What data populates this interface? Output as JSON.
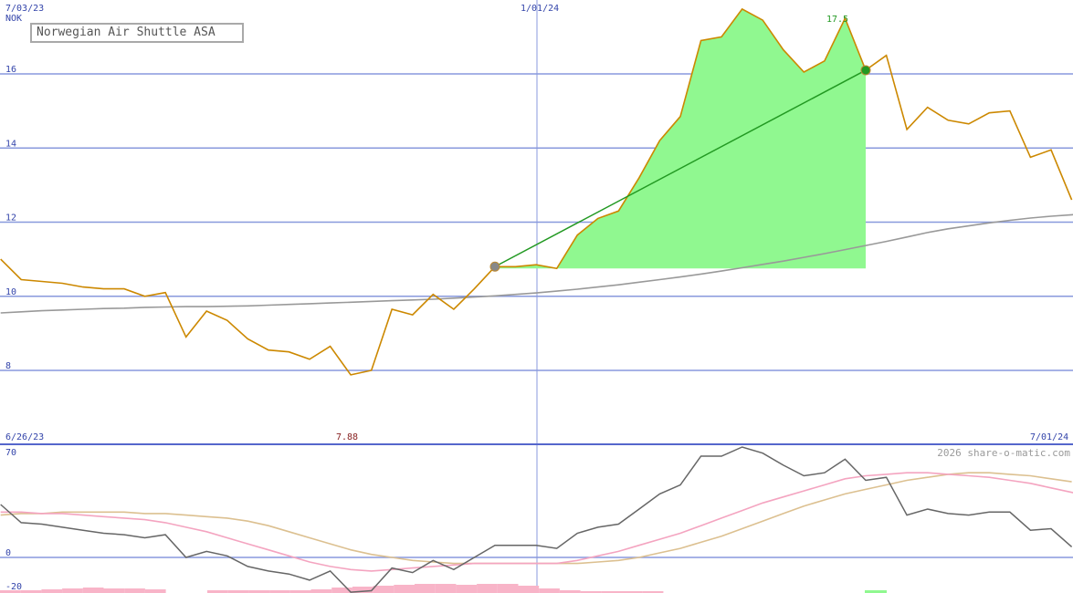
{
  "title": "Norwegian Air Shuttle ASA",
  "watermark": "2026 share-o-matic.com",
  "colors": {
    "price": "#cc8800",
    "ma": "#999999",
    "fill": "#90f890",
    "trend": "#229922",
    "grid": "#8899dd",
    "axis_text": "#3344aa",
    "high_label": "#229922",
    "low_label": "#882222",
    "osc_line": "#666666",
    "osc_pink": "#f4a4c0",
    "osc_tan": "#dcc090",
    "hist_pink": "#f8b4c8",
    "hist_green": "#90f890"
  },
  "chart_data": [
    {
      "type": "line",
      "name": "price",
      "date_labels": {
        "top_left": "7/03/23",
        "top_mid": "1/01/24",
        "bottom_left": "6/26/23",
        "bottom_right": "7/01/24"
      },
      "unit_label": "NOK",
      "ylim": [
        7.1,
        17.8
      ],
      "yticks": [
        8,
        10,
        12,
        14,
        16
      ],
      "high_label": "17.5",
      "low_label": "7.88",
      "series_price": [
        11.0,
        10.45,
        10.4,
        10.35,
        10.25,
        10.2,
        10.2,
        10.0,
        10.1,
        8.9,
        9.6,
        9.35,
        8.85,
        8.55,
        8.5,
        8.3,
        8.65,
        7.88,
        8.0,
        9.65,
        9.5,
        10.05,
        9.65,
        10.2,
        10.8,
        10.8,
        10.85,
        10.75,
        11.65,
        12.1,
        12.3,
        13.2,
        14.2,
        14.85,
        16.9,
        17.0,
        17.75,
        17.45,
        16.65,
        16.05,
        16.35,
        17.5,
        16.1,
        16.5,
        14.5,
        15.1,
        14.75,
        14.65,
        14.95,
        15.0,
        13.75,
        13.95,
        12.6
      ],
      "series_ma": [
        9.55,
        9.58,
        9.61,
        9.63,
        9.65,
        9.67,
        9.68,
        9.7,
        9.71,
        9.72,
        9.72,
        9.73,
        9.74,
        9.76,
        9.78,
        9.8,
        9.82,
        9.84,
        9.86,
        9.88,
        9.9,
        9.92,
        9.95,
        9.98,
        10.01,
        10.05,
        10.09,
        10.14,
        10.19,
        10.25,
        10.31,
        10.38,
        10.45,
        10.52,
        10.6,
        10.68,
        10.77,
        10.86,
        10.95,
        11.05,
        11.15,
        11.26,
        11.37,
        11.48,
        11.6,
        11.72,
        11.82,
        11.9,
        11.98,
        12.05,
        12.11,
        12.16,
        12.2,
        12.22
      ],
      "trend_start": [
        24,
        10.8
      ],
      "trend_end": [
        42,
        16.1
      ],
      "fill_base": 10.75
    },
    {
      "type": "line",
      "name": "oscillator",
      "ylim": [
        -20,
        70
      ],
      "yticks": [
        70,
        0,
        -20
      ],
      "series_main": [
        35,
        23,
        22,
        20,
        18,
        16,
        15,
        13,
        15,
        0,
        4,
        1,
        -6,
        -9,
        -11,
        -15,
        -9,
        -23,
        -22,
        -7,
        -10,
        -2,
        -8,
        0,
        8,
        8,
        8,
        6,
        16,
        20,
        22,
        32,
        42,
        48,
        67,
        67,
        73,
        69,
        61,
        54,
        56,
        65,
        51,
        53,
        28,
        32,
        29,
        28,
        30,
        30,
        18,
        19,
        7
      ],
      "series_pink": [
        30,
        30,
        29,
        29,
        28,
        27,
        26,
        25,
        23,
        20,
        17,
        13,
        9,
        5,
        1,
        -3,
        -6,
        -8,
        -9,
        -8,
        -7,
        -6,
        -5,
        -4,
        -4,
        -4,
        -4,
        -4,
        -2,
        1,
        4,
        8,
        12,
        16,
        21,
        26,
        31,
        36,
        40,
        44,
        48,
        52,
        54,
        55,
        56,
        56,
        55,
        54,
        53,
        51,
        49,
        46,
        43,
        40
      ],
      "series_tan": [
        28,
        29,
        29,
        30,
        30,
        30,
        30,
        29,
        29,
        28,
        27,
        26,
        24,
        21,
        17,
        13,
        9,
        5,
        2,
        0,
        -2,
        -3,
        -4,
        -4,
        -4,
        -4,
        -4,
        -4,
        -4,
        -3,
        -2,
        0,
        3,
        6,
        10,
        14,
        19,
        24,
        29,
        34,
        38,
        42,
        45,
        48,
        51,
        53,
        55,
        56,
        56,
        55,
        54,
        52,
        50
      ],
      "hist_pink": [
        3,
        3,
        4,
        5,
        6,
        5,
        5,
        4,
        0,
        0,
        3,
        3,
        3,
        3,
        3,
        4,
        6,
        7,
        8,
        9,
        10,
        10,
        9,
        10,
        10,
        8,
        5,
        3,
        2,
        2,
        2,
        2
      ],
      "hist_green_index": 42,
      "hist_green_value": 3
    }
  ]
}
